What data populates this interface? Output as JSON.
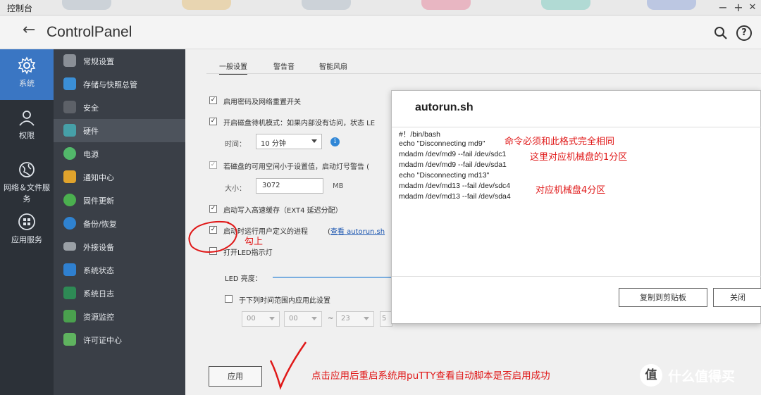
{
  "window": {
    "title": "控制台",
    "controls": [
      "−",
      "+",
      "✕"
    ]
  },
  "header": {
    "back_icon": "arrow-left-icon",
    "title": "ControlPanel",
    "search_icon": "search-icon",
    "help_icon": "help-icon",
    "help_glyph": "?"
  },
  "rail": [
    {
      "label": "系统",
      "icon": "gear-icon",
      "active": true
    },
    {
      "label": "权限",
      "icon": "user-icon",
      "active": false
    },
    {
      "label": "网络＆文件服务",
      "icon": "globe-icon",
      "active": false
    },
    {
      "label": "应用服务",
      "icon": "apps-grid-icon",
      "active": false
    }
  ],
  "menu": [
    {
      "label": "常规设置",
      "icon": "settings-icon",
      "color": "#8a8f96"
    },
    {
      "label": "存储与快照总管",
      "icon": "storage-icon",
      "color": "#3b8fd6"
    },
    {
      "label": "安全",
      "icon": "lock-icon",
      "color": "#5d6168"
    },
    {
      "label": "硬件",
      "icon": "hardware-icon",
      "color": "#46a0a8"
    },
    {
      "label": "电源",
      "icon": "bulb-icon",
      "color": "#52b86a"
    },
    {
      "label": "通知中心",
      "icon": "notification-icon",
      "color": "#e0a32c"
    },
    {
      "label": "固件更新",
      "icon": "firmware-icon",
      "color": "#4bb04f"
    },
    {
      "label": "备份/恢复",
      "icon": "backup-icon",
      "color": "#2f82d0"
    },
    {
      "label": "外接设备",
      "icon": "external-device-icon",
      "color": "#9aa0a6"
    },
    {
      "label": "系统状态",
      "icon": "monitor-icon",
      "color": "#2f80d0"
    },
    {
      "label": "系统日志",
      "icon": "log-icon",
      "color": "#2e8a55"
    },
    {
      "label": "资源监控",
      "icon": "resource-monitor-icon",
      "color": "#4aa04e"
    },
    {
      "label": "许可证中心",
      "icon": "license-icon",
      "color": "#5fb35f"
    }
  ],
  "tabs": [
    "一般设置",
    "警告音",
    "智能风扇"
  ],
  "settings": {
    "reset_switch": "启用密码及网络重置开关",
    "standby": "开启磁盘待机模式：如果内部没有访问，状态 LE",
    "time_label": "时间：",
    "time_value": "10 分钟",
    "info_glyph": "i",
    "free_space": "若磁盘的可用空间小于设置值，启动灯号警告 (",
    "size_label": "大小：",
    "size_value": "3072",
    "size_unit": "MB",
    "write_cache": "启动写入高速缓存（EXT4 延迟分配）",
    "autorun_prefix": "启动时运行用户定义的进程",
    "autorun_link": "查看 autorun.sh",
    "led_light": "打开LED指示灯",
    "led_brightness": "LED 亮度：",
    "schedule": "于下列时间范围内应用此设置",
    "sched_h1": "00",
    "sched_m1": "00",
    "sched_sep": "~",
    "sched_h2": "23",
    "sched_m2": "5",
    "apply": "应用"
  },
  "dialog": {
    "title": "autorun.sh",
    "lines": [
      "#！/bin/bash",
      "echo \"Disconnecting md9\"",
      "mdadm /dev/md9 --fail /dev/sdc1",
      "mdadm /dev/md9 --fail /dev/sda1",
      "echo \"Disconnecting md13\"",
      "mdadm /dev/md13 --fail /dev/sdc4",
      "mdadm /dev/md13 --fail /dev/sda4"
    ],
    "copy_button": "复制到剪贴板",
    "close_button": "关闭"
  },
  "annotations": {
    "format_note": "命令必须和此格式完全相同",
    "partition1_note": "这里对应机械盘的1分区",
    "partition4_note": "对应机械盘4分区",
    "check_note": "勾上",
    "reboot_note": "点击应用后重启系统用puTTY查看自动脚本是否启用成功"
  },
  "watermark": {
    "logo": "值",
    "text": "什么值得买"
  },
  "colors": {
    "rail_active": "#3a76c3",
    "annotation_red": "#e01818",
    "link": "#1a55b0"
  }
}
